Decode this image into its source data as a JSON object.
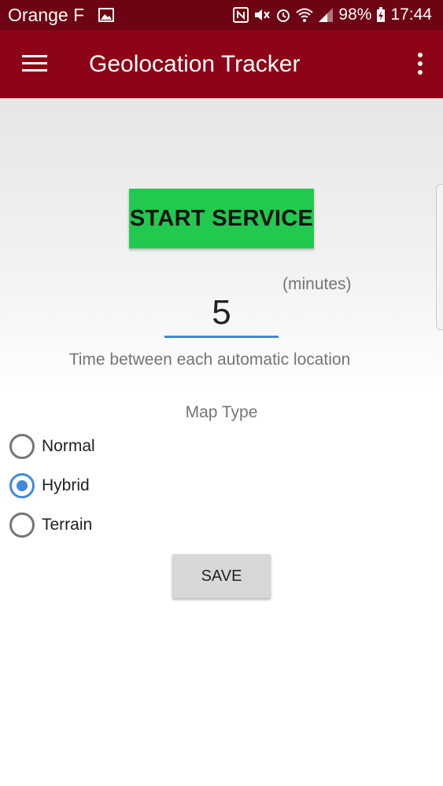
{
  "status_bar": {
    "carrier": "Orange F",
    "battery": "98%",
    "time": "17:44",
    "icons": [
      "gallery-icon",
      "nfc-icon",
      "mute-icon",
      "alarm-icon",
      "wifi-icon",
      "signal-icon",
      "battery-charging-icon"
    ]
  },
  "app_bar": {
    "title": "Geolocation Tracker",
    "icons": [
      "menu-icon",
      "overflow-menu-icon"
    ]
  },
  "service": {
    "start_label": "START SERVICE"
  },
  "interval": {
    "value": "5",
    "unit_label": "(minutes)",
    "help_text": "Time between each automatic location"
  },
  "map_type": {
    "label": "Map Type",
    "options": [
      {
        "label": "Normal",
        "checked": false
      },
      {
        "label": "Hybrid",
        "checked": true
      },
      {
        "label": "Terrain",
        "checked": false
      }
    ]
  },
  "save_label": "SAVE",
  "colors": {
    "status_bar": "#6e0313",
    "app_bar": "#8c0216",
    "start_button": "#22c94f",
    "accent": "#3f8ad8",
    "save_button": "#d6d7d7"
  }
}
